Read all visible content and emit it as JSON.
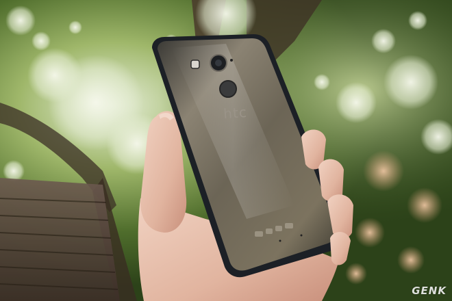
{
  "photo": {
    "subject": "hand-holding-phone",
    "phone_brand_logo": "htc",
    "watermark": "GENK",
    "colors": {
      "foliage_dark": "#2f4a1e",
      "foliage_mid": "#5e7f35",
      "foliage_light": "#b9cf78",
      "sky_bokeh": "#e9efe0",
      "branch": "#4a3a2c",
      "phone_back": "#6b6457",
      "phone_edge": "#1c2026",
      "skin": "#e8c2ae"
    }
  }
}
